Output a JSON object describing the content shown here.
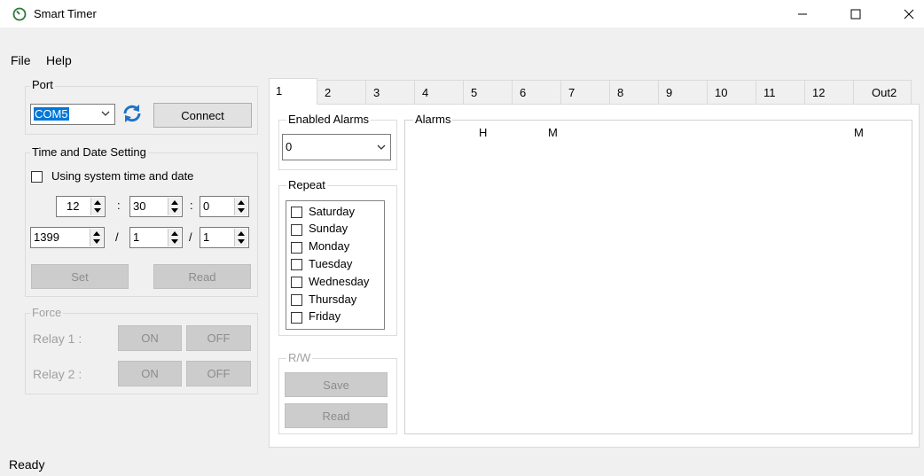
{
  "window": {
    "title": "Smart Timer"
  },
  "menu": {
    "file": "File",
    "help": "Help"
  },
  "port": {
    "legend": "Port",
    "selected": "COM5",
    "connect_label": "Connect"
  },
  "time_date": {
    "legend": "Time and Date Setting",
    "use_system_label": "Using system time and date",
    "hour": "12",
    "minute": "30",
    "second": "0",
    "time_sep": ":",
    "year": "1399",
    "month": "1",
    "day": "1",
    "date_sep": "/",
    "set_label": "Set",
    "read_label": "Read"
  },
  "force": {
    "legend": "Force",
    "relay1_label": "Relay 1 :",
    "relay2_label": "Relay 2 :",
    "on_label": "ON",
    "off_label": "OFF"
  },
  "tabs": [
    "1",
    "2",
    "3",
    "4",
    "5",
    "6",
    "7",
    "8",
    "9",
    "10",
    "11",
    "12",
    "Out2"
  ],
  "enabled_alarms": {
    "legend": "Enabled Alarms",
    "value": "0"
  },
  "repeat": {
    "legend": "Repeat",
    "days": [
      "Saturday",
      "Sunday",
      "Monday",
      "Tuesday",
      "Wednesday",
      "Thursday",
      "Friday"
    ]
  },
  "rw": {
    "legend": "R/W",
    "save_label": "Save",
    "read_label": "Read"
  },
  "alarms": {
    "legend": "Alarms",
    "h_label": "H",
    "m1_label": "M",
    "m2_label": "M"
  },
  "status": {
    "text": "Ready"
  },
  "colors": {
    "accent": "#0078d7",
    "refresh": "#1e73c8"
  }
}
